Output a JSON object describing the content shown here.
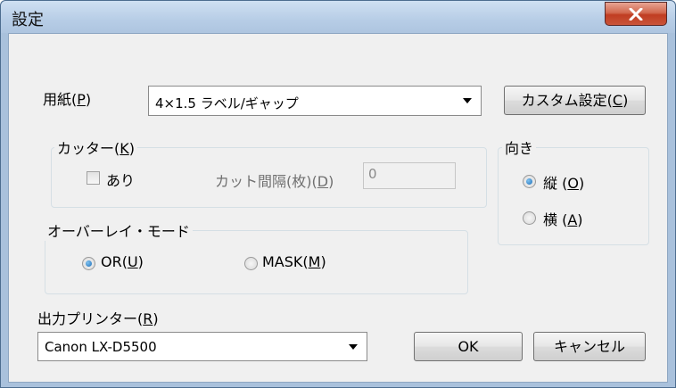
{
  "window": {
    "title": "設定"
  },
  "paper": {
    "label_pre": "用紙(",
    "label_key": "P",
    "label_post": ")",
    "value": "4×1.5 ラベル/ギャップ"
  },
  "custom_button": {
    "pre": "カスタム設定(",
    "key": "C",
    "post": ")"
  },
  "cutter": {
    "legend_pre": "カッター(",
    "legend_key": "K",
    "legend_post": ")",
    "checkbox_label": "あり",
    "interval_pre": "カット間隔(枚)(",
    "interval_key": "D",
    "interval_post": ")",
    "interval_value": "0"
  },
  "orientation": {
    "legend": "向き",
    "portrait": {
      "pre": "縦 (",
      "key": "O",
      "post": ")"
    },
    "landscape": {
      "pre": "横 (",
      "key": "A",
      "post": ")"
    }
  },
  "overlay": {
    "legend": "オーバーレイ・モード",
    "or": {
      "pre": "OR(",
      "key": "U",
      "post": ")"
    },
    "mask": {
      "pre": "MASK(",
      "key": "M",
      "post": ")"
    }
  },
  "printer": {
    "label_pre": "出力プリンター(",
    "label_key": "R",
    "label_post": ")",
    "value": "Canon LX-D5500"
  },
  "buttons": {
    "ok": "OK",
    "cancel": "キャンセル"
  }
}
